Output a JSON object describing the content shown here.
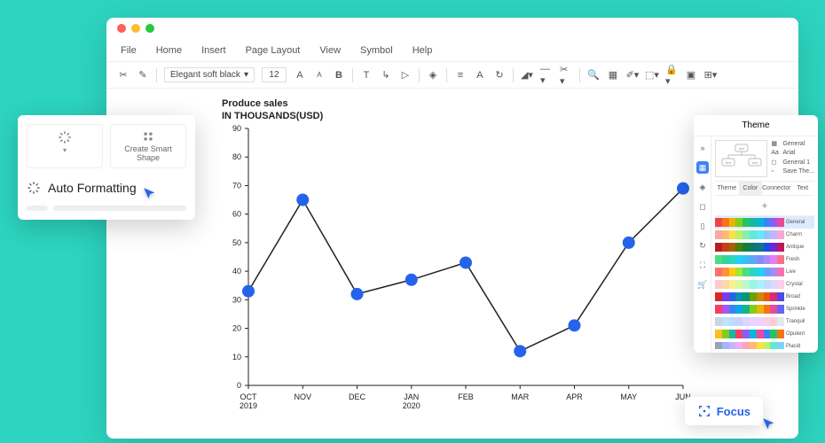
{
  "menubar": [
    "File",
    "Home",
    "Insert",
    "Page Layout",
    "View",
    "Symbol",
    "Help"
  ],
  "toolbar": {
    "font": "Elegant soft black",
    "size": "12"
  },
  "popup": {
    "create_shape": "Create Smart Shape",
    "auto_formatting": "Auto Formatting"
  },
  "theme": {
    "title": "Theme",
    "options": [
      "General",
      "Arial",
      "General 1",
      "Save The..."
    ],
    "tabs": [
      "Theme",
      "Color",
      "Connector",
      "Text"
    ],
    "palettes": [
      "General",
      "Charm",
      "Antique",
      "Fresh",
      "Live",
      "Crystal",
      "Broad",
      "Sprinkle",
      "Tranquil",
      "Opulent",
      "Placid"
    ]
  },
  "focus": {
    "label": "Focus"
  },
  "chart_data": {
    "type": "line",
    "title": "Produce sales",
    "subtitle": "IN THOUSANDS(USD)",
    "xlabel": "",
    "ylabel": "",
    "x_categories": [
      "OCT",
      "NOV",
      "DEC",
      "JAN",
      "FEB",
      "MAR",
      "APR",
      "MAY",
      "JUN"
    ],
    "x_sublabels": [
      "2019",
      "",
      "",
      "2020",
      "",
      "",
      "",
      "",
      ""
    ],
    "values": [
      33,
      65,
      32,
      37,
      43,
      12,
      21,
      50,
      69
    ],
    "ylim": [
      0,
      90
    ],
    "y_ticks": [
      0,
      10,
      20,
      30,
      40,
      50,
      60,
      70,
      80,
      90
    ]
  },
  "palette_colors": {
    "General": [
      "#ef4444",
      "#f97316",
      "#eab308",
      "#84cc16",
      "#22c55e",
      "#14b8a6",
      "#06b6d4",
      "#3b82f6",
      "#8b5cf6",
      "#ec4899"
    ],
    "Charm": [
      "#fca5a5",
      "#fdba74",
      "#fde047",
      "#bef264",
      "#86efac",
      "#5eead4",
      "#67e8f9",
      "#93c5fd",
      "#c4b5fd",
      "#f9a8d4"
    ],
    "Antique": [
      "#b91c1c",
      "#c2410c",
      "#a16207",
      "#4d7c0f",
      "#15803d",
      "#0f766e",
      "#0e7490",
      "#1d4ed8",
      "#6d28d9",
      "#be185d"
    ],
    "Fresh": [
      "#4ade80",
      "#34d399",
      "#2dd4bf",
      "#22d3ee",
      "#38bdf8",
      "#60a5fa",
      "#818cf8",
      "#a78bfa",
      "#e879f9",
      "#fb7185"
    ],
    "Live": [
      "#f87171",
      "#fb923c",
      "#facc15",
      "#a3e635",
      "#4ade80",
      "#2dd4bf",
      "#22d3ee",
      "#60a5fa",
      "#a78bfa",
      "#f472b6"
    ],
    "Crystal": [
      "#fecaca",
      "#fed7aa",
      "#fef08a",
      "#d9f99d",
      "#bbf7d0",
      "#99f6e4",
      "#a5f3fc",
      "#bfdbfe",
      "#ddd6fe",
      "#fbcfe8"
    ],
    "Broad": [
      "#dc2626",
      "#7c3aed",
      "#2563eb",
      "#0891b2",
      "#059669",
      "#65a30d",
      "#ca8a04",
      "#ea580c",
      "#db2777",
      "#4f46e5"
    ],
    "Sprinkle": [
      "#f43f5e",
      "#a855f7",
      "#3b82f6",
      "#0ea5e9",
      "#10b981",
      "#84cc16",
      "#eab308",
      "#f97316",
      "#ec4899",
      "#6366f1"
    ],
    "Tranquil": [
      "#cbd5e1",
      "#bae6fd",
      "#bfdbfe",
      "#c7d2fe",
      "#ddd6fe",
      "#e9d5ff",
      "#f5d0fe",
      "#fbcfe8",
      "#fecdd3",
      "#e2e8f0"
    ],
    "Opulent": [
      "#fbbf24",
      "#84cc16",
      "#14b8a6",
      "#f43f5e",
      "#8b5cf6",
      "#06b6d4",
      "#ec4899",
      "#3b82f6",
      "#22c55e",
      "#f97316"
    ],
    "Placid": [
      "#94a3b8",
      "#a5b4fc",
      "#c4b5fd",
      "#f0abfc",
      "#fda4af",
      "#fdba74",
      "#fde047",
      "#bef264",
      "#5eead4",
      "#7dd3fc"
    ]
  }
}
